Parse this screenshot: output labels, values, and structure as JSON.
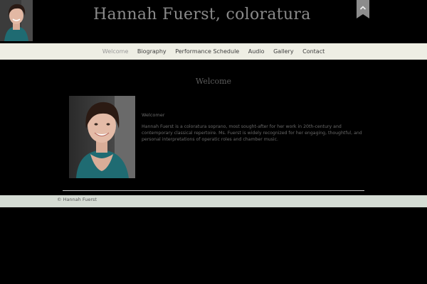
{
  "header": {
    "site_title": "Hannah Fuerst, coloratura",
    "thumb_alt": "Hannah Fuerst portrait"
  },
  "nav": {
    "items": [
      {
        "label": "Welcome",
        "active": true
      },
      {
        "label": "Biography",
        "active": false
      },
      {
        "label": "Performance Schedule",
        "active": false
      },
      {
        "label": "Audio",
        "active": false
      },
      {
        "label": "Gallery",
        "active": false
      },
      {
        "label": "Contact",
        "active": false
      }
    ]
  },
  "main": {
    "heading": "Welcome",
    "greeting": "Welcomer",
    "bio": "Hannah Fuerst is a coloratura soprano, most sought-after for her work in 20th-century and contemporary classical repertoire. Ms. Fuerst is widely recognized for her engaging, thoughtful, and personal interpretations of operatic roles and chamber music."
  },
  "footer": {
    "copyright": "© Hannah Fuerst"
  },
  "colors": {
    "background": "#000000",
    "nav_bg": "#eeeee4",
    "footer_bg": "#d5dcd4",
    "ribbon": "#8c8c8c",
    "dress_teal": "#1f6b72"
  },
  "icons": {
    "back_to_top": "chevron-up-icon"
  }
}
